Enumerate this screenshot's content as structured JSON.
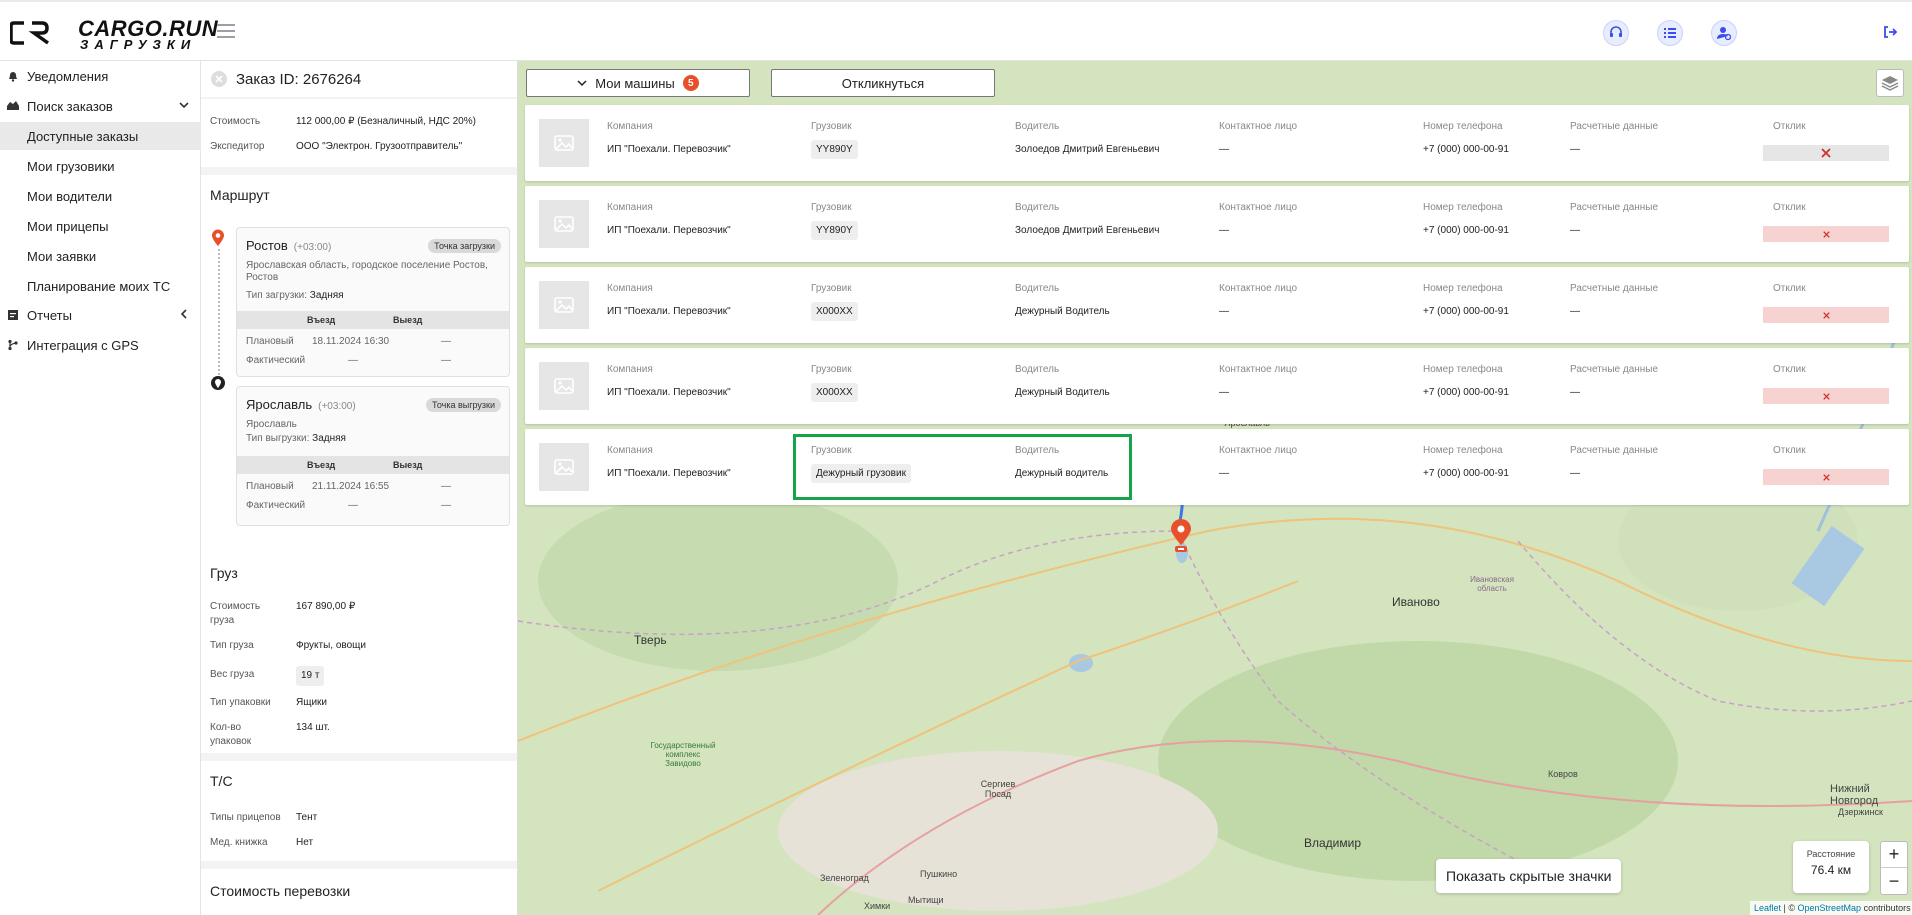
{
  "brand": {
    "name": "CARGO.RUN",
    "sub": "ЗАГРУЗКИ"
  },
  "colors": {
    "accent": "#e8502a",
    "highlight": "#17a34a",
    "header_btn": "#3b4cf0",
    "response_bg": "#f6d3d0"
  },
  "header": {
    "buttons": [
      "headset-icon",
      "list-icon",
      "user-settings-icon"
    ],
    "logout_icon": "logout-icon"
  },
  "sidebar": {
    "items": [
      {
        "label": "Уведомления",
        "icon": "bell-icon"
      },
      {
        "label": "Поиск заказов",
        "icon": "truck-icon"
      },
      {
        "label": "Доступные заказы"
      },
      {
        "label": "Мои грузовики"
      },
      {
        "label": "Мои водители"
      },
      {
        "label": "Мои прицепы"
      },
      {
        "label": "Мои заявки"
      },
      {
        "label": "Планирование моих ТС"
      },
      {
        "label": "Отчеты",
        "icon": "report-icon"
      },
      {
        "label": "Интеграция с GPS",
        "icon": "gps-icon"
      }
    ]
  },
  "order": {
    "title": "Заказ ID: 2676264",
    "cost_label": "Стоимость",
    "cost_value": "112 000,00 ₽ (Безналичный, НДС 20%)",
    "forwarder_label": "Экспедитор",
    "forwarder_value": "ООО \"Электрон. Грузоотправитель\"",
    "route_title": "Маршрут",
    "points": [
      {
        "city": "Ростов",
        "tz": "(+03:00)",
        "tag": "Точка загрузки",
        "address": "Ярославская область, городское поселение Ростов, Ростов",
        "type_label": "Тип загрузки:",
        "type_value": "Задняя",
        "col1": "Въезд",
        "col2": "Выезд",
        "plan_label": "Плановый",
        "plan_in": "18.11.2024 16:30",
        "plan_out": "—",
        "fact_label": "Фактический",
        "fact_in": "—",
        "fact_out": "—"
      },
      {
        "city": "Ярославль",
        "tz": "(+03:00)",
        "tag": "Точка выгрузки",
        "address": "Ярославль",
        "type_label": "Тип выгрузки:",
        "type_value": "Задняя",
        "col1": "Въезд",
        "col2": "Выезд",
        "plan_label": "Плановый",
        "plan_in": "21.11.2024 16:55",
        "plan_out": "—",
        "fact_label": "Фактический",
        "fact_in": "—",
        "fact_out": "—"
      }
    ],
    "cargo_title": "Груз",
    "cargo": [
      {
        "k": "Стоимость груза",
        "v": "167 890,00 ₽"
      },
      {
        "k": "Тип груза",
        "v": "Фрукты, овощи"
      },
      {
        "k": "Вес груза",
        "v": "19 т"
      },
      {
        "k": "Тип упаковки",
        "v": "Ящики"
      },
      {
        "k": "Кол-во упаковок",
        "v": "134 шт."
      }
    ],
    "ts_title": "Т/С",
    "ts": [
      {
        "k": "Типы прицепов",
        "v": "Тент"
      },
      {
        "k": "Мед. книжка",
        "v": "Нет"
      }
    ],
    "next_title": "Стоимость перевозки"
  },
  "map": {
    "my_cars_label": "Мои машины",
    "my_cars_count": "5",
    "respond_label": "Откликнуться",
    "columns": {
      "company": "Компания",
      "truck": "Грузовик",
      "driver": "Водитель",
      "contact": "Контактное лицо",
      "phone": "Номер телефона",
      "payment": "Расчетные данные",
      "response": "Отклик"
    },
    "trucks": [
      {
        "company": "ИП \"Поехали. Перевозчик\"",
        "truck": "YY890Y",
        "driver": "Золоедов Дмитрий Евгеньевич",
        "contact": "—",
        "phone": "+7 (000) 000-00-91",
        "payment": "—"
      },
      {
        "company": "ИП \"Поехали. Перевозчик\"",
        "truck": "YY890Y",
        "driver": "Золоедов Дмитрий Евгеньевич",
        "contact": "—",
        "phone": "+7 (000) 000-00-91",
        "payment": "—"
      },
      {
        "company": "ИП \"Поехали. Перевозчик\"",
        "truck": "X000XX",
        "driver": "Дежурный Водитель",
        "contact": "—",
        "phone": "+7 (000) 000-00-91",
        "payment": "—"
      },
      {
        "company": "ИП \"Поехали. Перевозчик\"",
        "truck": "X000XX",
        "driver": "Дежурный Водитель",
        "contact": "—",
        "phone": "+7 (000) 000-00-91",
        "payment": "—"
      },
      {
        "company": "ИП \"Поехали. Перевозчик\"",
        "truck": "Дежурный грузовик",
        "driver": "Дежурный водитель",
        "contact": "—",
        "phone": "+7 (000) 000-00-91",
        "payment": "—"
      }
    ],
    "labels": {
      "tver": "Тверь",
      "ivanovo": "Иваново",
      "vladimir": "Владимир",
      "sergiev": "Сергиев Посад",
      "zelenograd": "Зеленоград",
      "pushkino": "Пушкино",
      "khimki": "Химки",
      "mytishchi": "Мытищи",
      "kovrov": "Ковров",
      "nizhny": "Нижний Новгород",
      "dzerzhinsk": "Дзержинск",
      "yaroslavl": "Ярославль",
      "ivanovo_obl": "Ивановская область",
      "zavidovo": "Государственный комплекс Завидово"
    },
    "distance_label": "Расстояние",
    "distance_value": "76.4 км",
    "show_hidden": "Показать скрытые значки",
    "zoom_in": "+",
    "zoom_out": "−",
    "attrib_leaflet": "Leaflet",
    "attrib_sep": " | © ",
    "attrib_osm": "OpenStreetMap",
    "attrib_tail": " contributors"
  }
}
